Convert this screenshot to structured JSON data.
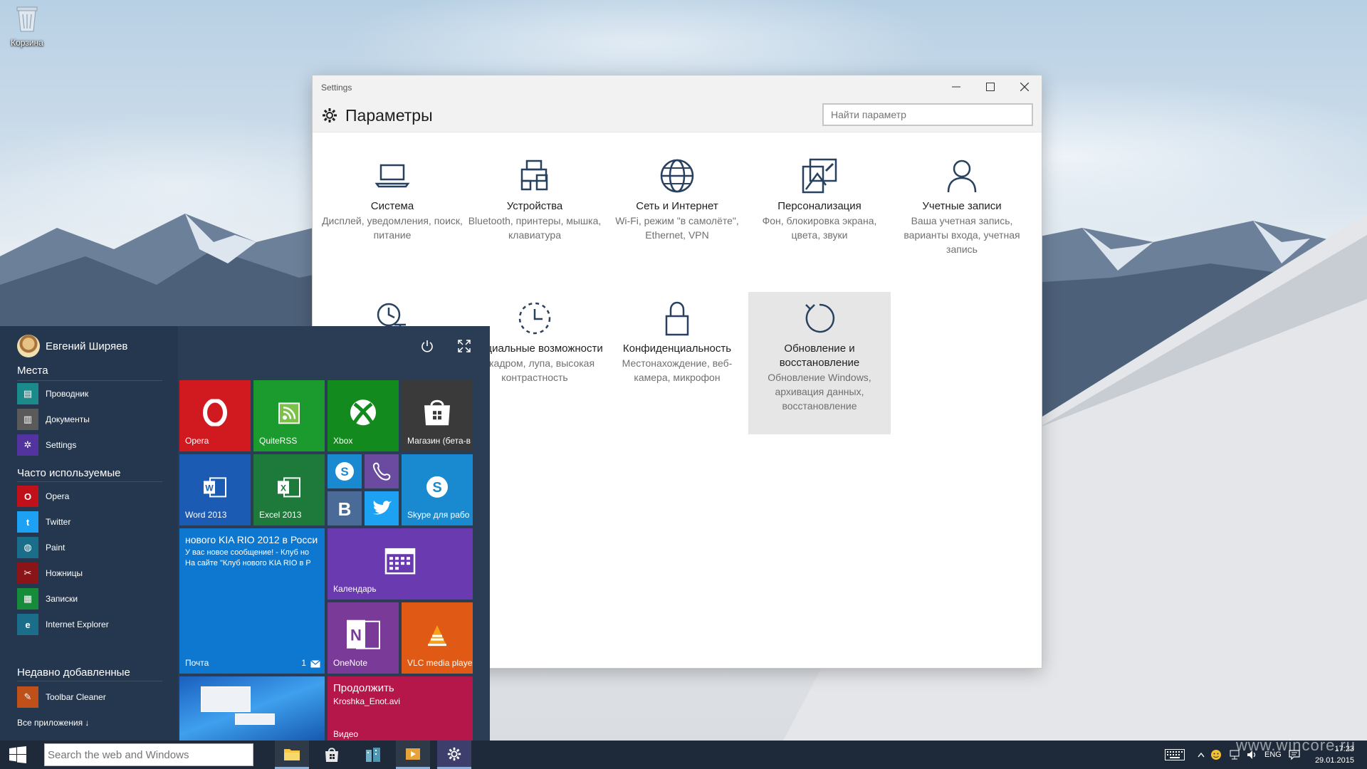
{
  "desktop": {
    "recycle_bin_label": "Корзина"
  },
  "settings_window": {
    "window_title": "Settings",
    "header_title": "Параметры",
    "search_placeholder": "Найти параметр",
    "categories": [
      {
        "title": "Система",
        "desc": "Дисплей, уведомления, поиск, питание",
        "icon": "laptop-icon"
      },
      {
        "title": "Устройства",
        "desc": "Bluetooth, принтеры, мышка, клавиатура",
        "icon": "devices-icon"
      },
      {
        "title": "Сеть и Интернет",
        "desc": "Wi-Fi, режим \"в самолёте\", Ethernet, VPN",
        "icon": "globe-icon"
      },
      {
        "title": "Персонализация",
        "desc": "Фон, блокировка экрана, цвета, звуки",
        "icon": "personalization-icon"
      },
      {
        "title": "Учетные записи",
        "desc": "Ваша учетная запись, варианты входа, учетная запись",
        "icon": "person-icon"
      },
      {
        "title": "",
        "desc": "",
        "icon": "time-language-icon"
      },
      {
        "title": "Специальные возможности",
        "desc": "За кадром, лупа, высокая контрастность",
        "icon": "ease-of-access-icon"
      },
      {
        "title": "Конфиденциальность",
        "desc": "Местонахождение, веб-камера, микрофон",
        "icon": "lock-icon"
      },
      {
        "title": "Обновление и восстановление",
        "desc": "Обновление Windows, архивация данных, восстановление",
        "icon": "update-icon"
      }
    ]
  },
  "start_menu": {
    "user_name": "Евгений Ширяев",
    "places_header": "Места",
    "places": [
      {
        "label": "Проводник",
        "color": "#1a8a8a"
      },
      {
        "label": "Документы",
        "color": "#5a5a5a"
      },
      {
        "label": "Settings",
        "color": "#5233a0"
      }
    ],
    "frequent_header": "Часто используемые",
    "frequent": [
      {
        "label": "Opera",
        "color": "#c0101a"
      },
      {
        "label": "Twitter",
        "color": "#1da1f2"
      },
      {
        "label": "Paint",
        "color": "#1a6e8a"
      },
      {
        "label": "Ножницы",
        "color": "#8a1418"
      },
      {
        "label": "Записки",
        "color": "#168c3a"
      },
      {
        "label": "Internet Explorer",
        "color": "#1a6e8a"
      }
    ],
    "recent_header": "Недавно добавленные",
    "recent": [
      {
        "label": "Toolbar Cleaner",
        "color": "#c0501a"
      }
    ],
    "all_apps": "Все приложения ↓",
    "tiles": {
      "opera": "Opera",
      "quiterss": "QuiteRSS",
      "xbox": "Xbox",
      "store": "Магазин (бета-в",
      "word": "Word 2013",
      "excel": "Excel 2013",
      "skype_business": "Skype для рабо",
      "mail_title": "нового KIA RIO 2012 в Росси",
      "mail_line1": "У вас новое сообщение! - Клуб но",
      "mail_line2": "На сайте \"Клуб нового KIA RIO в Р",
      "mail_label": "Почта",
      "mail_count": "1",
      "calendar": "Календарь",
      "onenote": "OneNote",
      "vlc": "VLC media playe",
      "video_title": "Продолжить",
      "video_file": "Kroshka_Enot.avi",
      "video_label": "Видео"
    }
  },
  "taskbar": {
    "search_placeholder": "Search the web and Windows",
    "language": "ENG",
    "time": "17:23",
    "date": "29.01.2015"
  },
  "watermark": "www.wincore.ru"
}
